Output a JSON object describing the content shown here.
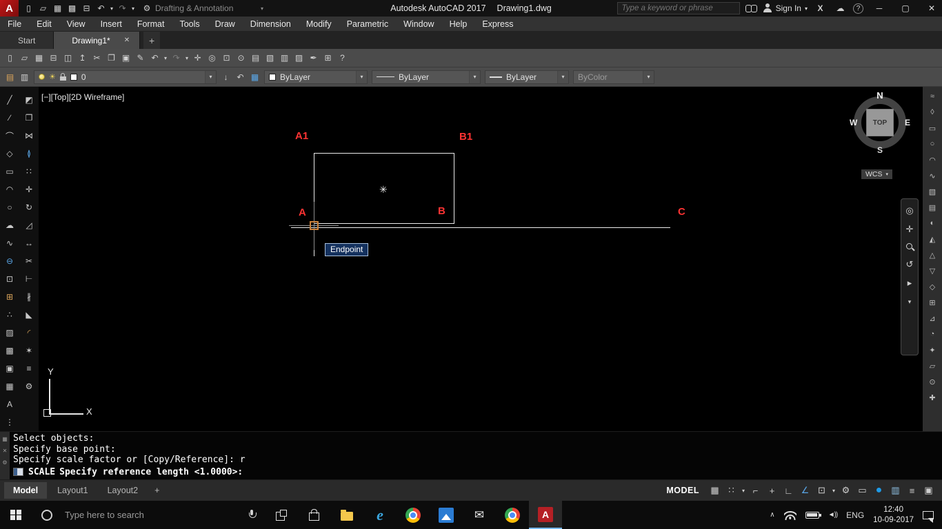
{
  "colors": {
    "accent_red": "#c01616",
    "canvas_bg": "#000000",
    "label_red": "#ff3333",
    "snap_marker_orange": "#c9803a",
    "tooltip_bg": "#14315e",
    "hardware_accel_blue": "#1e9be8",
    "taskbar_highlight_blue": "#76b9ed"
  },
  "titlebar": {
    "workspace": "Drafting & Annotation",
    "app_title": "Autodesk AutoCAD 2017",
    "doc_title": "Drawing1.dwg",
    "search_placeholder": "Type a keyword or phrase",
    "sign_in": "Sign In",
    "x_logo": "X",
    "cloud_glyph": "☁",
    "help_glyph": "?",
    "workspace_gear": "⚙",
    "workspace_arrow": "▾",
    "signin_arrow": "▾",
    "window_controls": {
      "minimize": "─",
      "maximize": "▢",
      "close": "✕"
    },
    "quick_icons": [
      {
        "name": "qa-new-icon",
        "glyph": "▯"
      },
      {
        "name": "qa-open-icon",
        "glyph": "▱"
      },
      {
        "name": "qa-save-icon",
        "glyph": "▦"
      },
      {
        "name": "qa-saveas-icon",
        "glyph": "▩"
      },
      {
        "name": "qa-plot-icon",
        "glyph": "⊟"
      },
      {
        "name": "qa-undo-icon",
        "glyph": "↶"
      },
      {
        "name": "qa-undo-arrow-icon",
        "glyph": "▾",
        "cls": "arrow-i"
      },
      {
        "name": "qa-redo-icon",
        "glyph": "↷",
        "cls": "dim"
      },
      {
        "name": "qa-redo-arrow-icon",
        "glyph": "▾",
        "cls": "arrow-i"
      }
    ]
  },
  "menubar": {
    "items": [
      {
        "label": "File",
        "name": "menu-file"
      },
      {
        "label": "Edit",
        "name": "menu-edit"
      },
      {
        "label": "View",
        "name": "menu-view"
      },
      {
        "label": "Insert",
        "name": "menu-insert"
      },
      {
        "label": "Format",
        "name": "menu-format"
      },
      {
        "label": "Tools",
        "name": "menu-tools"
      },
      {
        "label": "Draw",
        "name": "menu-draw"
      },
      {
        "label": "Dimension",
        "name": "menu-dimension"
      },
      {
        "label": "Modify",
        "name": "menu-modify"
      },
      {
        "label": "Parametric",
        "name": "menu-parametric"
      },
      {
        "label": "Window",
        "name": "menu-window"
      },
      {
        "label": "Help",
        "name": "menu-help"
      },
      {
        "label": "Express",
        "name": "menu-express"
      }
    ]
  },
  "filetabs": {
    "start": "Start",
    "active": "Drawing1*",
    "close": "✕",
    "add": "+"
  },
  "toolbar_main": {
    "icons": [
      {
        "name": "new-file-icon",
        "glyph": "▯"
      },
      {
        "name": "open-file-icon",
        "glyph": "▱"
      },
      {
        "name": "save-icon",
        "glyph": "▦"
      },
      {
        "name": "plot-icon",
        "glyph": "⊟"
      },
      {
        "name": "plot-preview-icon",
        "glyph": "◫"
      },
      {
        "name": "publish-icon",
        "glyph": "↥"
      },
      {
        "name": "cut-icon",
        "glyph": "✂"
      },
      {
        "name": "copy-icon",
        "glyph": "❐"
      },
      {
        "name": "paste-icon",
        "glyph": "▣"
      },
      {
        "name": "match-properties-icon",
        "glyph": "✎"
      },
      {
        "name": "undo-icon",
        "glyph": "↶"
      },
      {
        "name": "undo-dropdown-icon",
        "glyph": "▾",
        "cls": "arrow-i"
      },
      {
        "name": "redo-icon",
        "glyph": "↷",
        "cls": "dim"
      },
      {
        "name": "redo-dropdown-icon",
        "glyph": "▾",
        "cls": "arrow-i"
      },
      {
        "name": "pan-icon",
        "glyph": "✛"
      },
      {
        "name": "zoom-realtime-icon",
        "glyph": "◎"
      },
      {
        "name": "zoom-window-icon",
        "glyph": "⊡"
      },
      {
        "name": "zoom-previous-icon",
        "glyph": "⊙"
      },
      {
        "name": "properties-icon",
        "glyph": "▤"
      },
      {
        "name": "designcenter-icon",
        "glyph": "▧"
      },
      {
        "name": "toolpalettes-icon",
        "glyph": "▥"
      },
      {
        "name": "sheetset-icon",
        "glyph": "▨"
      },
      {
        "name": "markup-icon",
        "glyph": "✒"
      },
      {
        "name": "quickcalc-icon",
        "glyph": "⊞"
      },
      {
        "name": "help-icon",
        "glyph": "?"
      }
    ]
  },
  "properties_bar": {
    "left_icons": [
      {
        "name": "layer-properties-icon",
        "glyph": "▤",
        "cls": "c-or"
      },
      {
        "name": "layer-states-icon",
        "glyph": "▥"
      }
    ],
    "freeze_glyph": "☀",
    "layer_value": "0",
    "arrow": "▾",
    "mid_icons": [
      {
        "name": "make-object-layer-current-icon",
        "glyph": "↓"
      },
      {
        "name": "layer-previous-icon",
        "glyph": "↶"
      },
      {
        "name": "layer-states-manager-icon",
        "glyph": "▦",
        "cls": "c-blue"
      }
    ],
    "color_value": "ByLayer",
    "linetype_value": "ByLayer",
    "lineweight_value": "ByLayer",
    "plotstyle_value": "ByColor"
  },
  "left_toolbar": {
    "col1": [
      {
        "name": "line-tool-icon",
        "glyph": "╱"
      },
      {
        "name": "construction-line-icon",
        "glyph": "∕"
      },
      {
        "name": "polyline-icon",
        "glyph": "⌒"
      },
      {
        "name": "polygon-icon",
        "glyph": "◇"
      },
      {
        "name": "rectangle-icon",
        "glyph": "▭"
      },
      {
        "name": "arc-icon",
        "glyph": "◠"
      },
      {
        "name": "circle-icon",
        "glyph": "○"
      },
      {
        "name": "revcloud-icon",
        "glyph": "☁"
      },
      {
        "name": "spline-icon",
        "glyph": "∿"
      },
      {
        "name": "ellipse-icon",
        "glyph": "⊖",
        "cls": "c-blue"
      },
      {
        "name": "insert-block-icon",
        "glyph": "⊡"
      },
      {
        "name": "make-block-icon",
        "glyph": "⊞",
        "cls": "c-or"
      },
      {
        "name": "point-icon",
        "glyph": "∴"
      },
      {
        "name": "hatch-icon",
        "glyph": "▨"
      },
      {
        "name": "gradient-icon",
        "glyph": "▩"
      },
      {
        "name": "region-icon",
        "glyph": "▣"
      },
      {
        "name": "table-icon",
        "glyph": "▦"
      },
      {
        "name": "mtext-icon",
        "glyph": "A"
      },
      {
        "name": "more-tools-icon",
        "glyph": "⋮"
      }
    ],
    "col2": [
      {
        "name": "erase-icon",
        "glyph": "◩"
      },
      {
        "name": "copy-object-icon",
        "glyph": "❐"
      },
      {
        "name": "mirror-icon",
        "glyph": "⋈"
      },
      {
        "name": "offset-icon",
        "glyph": "≬",
        "cls": "c-blue"
      },
      {
        "name": "array-icon",
        "glyph": "∷"
      },
      {
        "name": "move-icon",
        "glyph": "✛"
      },
      {
        "name": "rotate-icon",
        "glyph": "↻"
      },
      {
        "name": "scale-icon",
        "glyph": "◿"
      },
      {
        "name": "stretch-icon",
        "glyph": "↔"
      },
      {
        "name": "trim-icon",
        "glyph": "✂"
      },
      {
        "name": "extend-icon",
        "glyph": "⊢"
      },
      {
        "name": "break-icon",
        "glyph": "∦"
      },
      {
        "name": "chamfer-icon",
        "glyph": "◣"
      },
      {
        "name": "fillet-icon",
        "glyph": "◜",
        "cls": "c-or"
      },
      {
        "name": "explode-icon",
        "glyph": "✶"
      },
      {
        "name": "join-icon",
        "glyph": "≡"
      },
      {
        "name": "modify-settings-icon",
        "glyph": "⚙"
      }
    ]
  },
  "right_toolbar": {
    "icons": [
      {
        "name": "modeling-tool-icon",
        "glyph": "≈"
      },
      {
        "name": "modeling-tool-icon",
        "glyph": "◊"
      },
      {
        "name": "modeling-tool-icon",
        "glyph": "▭"
      },
      {
        "name": "modeling-tool-icon",
        "glyph": "○"
      },
      {
        "name": "modeling-tool-icon",
        "glyph": "◠"
      },
      {
        "name": "modeling-tool-icon",
        "glyph": "∿"
      },
      {
        "name": "modeling-tool-icon",
        "glyph": "▧"
      },
      {
        "name": "modeling-tool-icon",
        "glyph": "▤"
      },
      {
        "name": "modeling-tool-icon",
        "glyph": "◐"
      },
      {
        "name": "modeling-tool-icon",
        "glyph": "◭"
      },
      {
        "name": "modeling-tool-icon",
        "glyph": "△"
      },
      {
        "name": "modeling-tool-icon",
        "glyph": "▽"
      },
      {
        "name": "modeling-tool-icon",
        "glyph": "◇"
      },
      {
        "name": "modeling-tool-icon",
        "glyph": "⊞"
      },
      {
        "name": "modeling-tool-icon",
        "glyph": "⊿"
      },
      {
        "name": "modeling-tool-icon",
        "glyph": "◔"
      },
      {
        "name": "modeling-tool-icon",
        "glyph": "✦"
      },
      {
        "name": "modeling-tool-icon",
        "glyph": "▱"
      },
      {
        "name": "modeling-tool-icon",
        "glyph": "⊙"
      },
      {
        "name": "modeling-tool-icon",
        "glyph": "✚"
      }
    ]
  },
  "canvas": {
    "viewport_label": "[−][Top][2D Wireframe]",
    "labels": {
      "a1": "A1",
      "b1": "B1",
      "a": "A",
      "b": "B",
      "c": "C"
    },
    "tooltip": "Endpoint",
    "star": "✳",
    "ucs": {
      "x": "X",
      "y": "Y"
    },
    "viewcube": {
      "n": "N",
      "e": "E",
      "s": "S",
      "w": "W",
      "top": "TOP",
      "wcs": "WCS",
      "wcs_arrow": "▾"
    },
    "navbar": {
      "wheel": "◎",
      "pan": "✛",
      "orbit": "↺",
      "showmotion": "▸",
      "menu": "▾"
    }
  },
  "command": {
    "dock_icons": [
      {
        "name": "command-grip-icon",
        "glyph": "▦"
      },
      {
        "name": "command-close-icon",
        "glyph": "✕"
      },
      {
        "name": "command-settings-icon",
        "glyph": "⚙"
      }
    ],
    "history": [
      "Select objects:",
      "Specify base point:",
      "Specify scale factor or [Copy/Reference]: r"
    ],
    "command": "SCALE",
    "prompt": "Specify reference length <1.0000>:"
  },
  "layout_bar": {
    "model": "Model",
    "layout1": "Layout1",
    "layout2": "Layout2",
    "add": "+"
  },
  "statusbar": {
    "model_badge": "MODEL",
    "icons": [
      {
        "name": "grid-icon",
        "glyph": "▦"
      },
      {
        "name": "snap-icon",
        "glyph": "∷"
      },
      {
        "name": "snap-dropdown-icon",
        "glyph": "▾",
        "cls": "arrow-i"
      },
      {
        "name": "infer-constraints-icon",
        "glyph": "⌐"
      },
      {
        "name": "dynamic-input-icon",
        "glyph": "+"
      },
      {
        "name": "ortho-icon",
        "glyph": "∟"
      },
      {
        "name": "polar-tracking-icon",
        "glyph": "∠",
        "cls": "c-blue"
      },
      {
        "name": "osnap-icon",
        "glyph": "⊡"
      },
      {
        "name": "osnap-dropdown-icon",
        "glyph": "▾",
        "cls": "arrow-i"
      },
      {
        "name": "workspace-gear-icon",
        "glyph": "⚙"
      },
      {
        "name": "annotation-scale-icon",
        "glyph": "▭"
      },
      {
        "name": "hardware-acceleration-icon",
        "glyph": "●",
        "cls": "c-bluedot"
      },
      {
        "name": "clean-screen-icon",
        "glyph": "▥",
        "cls": "c-img"
      },
      {
        "name": "customize-icon",
        "glyph": "≡"
      },
      {
        "name": "status-more-icon",
        "glyph": "▣"
      }
    ]
  },
  "taskbar": {
    "search_placeholder": "Type here to search",
    "edge_letter": "e",
    "acad_letter": "A",
    "language": "ENG",
    "time": "12:40",
    "date": "10-09-2017"
  }
}
